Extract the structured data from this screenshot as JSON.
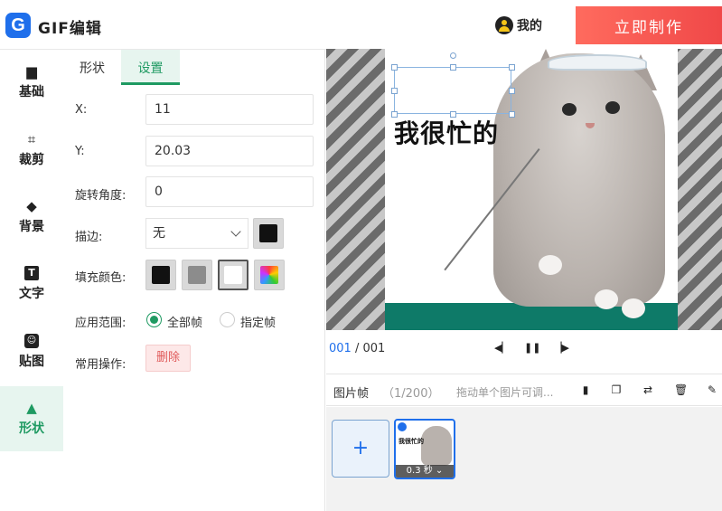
{
  "header": {
    "logo_letter": "G",
    "title": "GIF编辑",
    "user_label": "我的",
    "make_button": "立即制作"
  },
  "sidebar": {
    "items": [
      {
        "label": "基础",
        "icon": "folder-icon"
      },
      {
        "label": "裁剪",
        "icon": "crop-icon"
      },
      {
        "label": "背景",
        "icon": "paint-bucket-icon"
      },
      {
        "label": "文字",
        "icon": "text-icon"
      },
      {
        "label": "贴图",
        "icon": "sticker-icon"
      },
      {
        "label": "形状",
        "icon": "triangle-icon",
        "active": true
      }
    ]
  },
  "panel": {
    "tabs": [
      "形状",
      "设置"
    ],
    "active_tab": "设置",
    "x_label": "X:",
    "x_value": "11",
    "y_label": "Y:",
    "y_value": "20.03",
    "rotate_label": "旋转角度:",
    "rotate_value": "0",
    "stroke_label": "描边:",
    "stroke_value": "无",
    "stroke_color": "#111111",
    "fill_label": "填充颜色:",
    "fill_colors": [
      "#111111",
      "#8c8c8c",
      "#ffffff",
      "rainbow"
    ],
    "scope_label": "应用范围:",
    "scope_all": "全部帧",
    "scope_selected": "指定帧",
    "scope_value": "全部帧",
    "ops_label": "常用操作:",
    "delete_button": "删除"
  },
  "canvas": {
    "overlay_text": "我很忙的"
  },
  "playback": {
    "current": "001",
    "separator": " / ",
    "total": "001"
  },
  "frames": {
    "title": "图片帧",
    "count": "（1/200）",
    "hint": "拖动单个图片可调...",
    "add_label": "+",
    "thumb_text": "我很忙的",
    "thumb_duration": "0.3 秒 ⌄"
  },
  "colors": {
    "accent": "#1f9a62",
    "primary": "#1f6feb",
    "make_button": "#f04848"
  }
}
